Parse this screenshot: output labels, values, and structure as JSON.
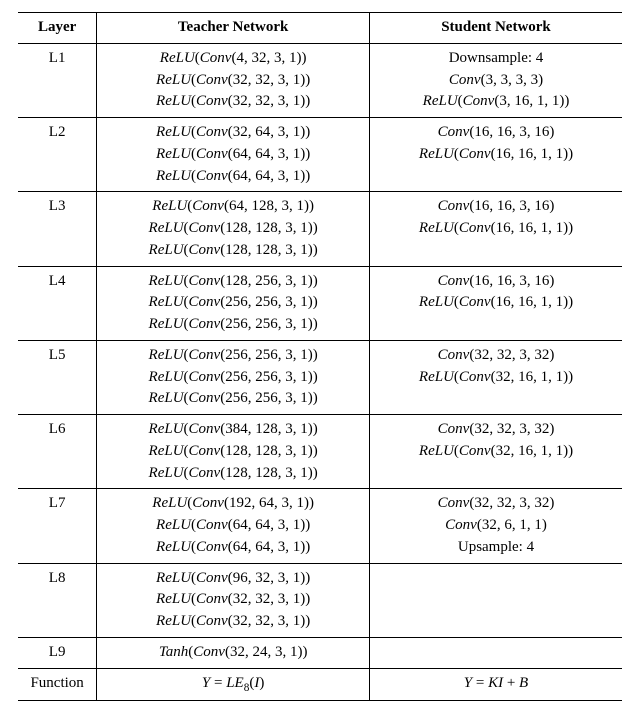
{
  "chart_data": {
    "type": "table",
    "columns": [
      "Layer",
      "Teacher Network",
      "Student Network"
    ],
    "rows": [
      {
        "layer": "L1",
        "teacher": [
          "ReLU(Conv(4, 32, 3, 1))",
          "ReLU(Conv(32, 32, 3, 1))",
          "ReLU(Conv(32, 32, 3, 1))"
        ],
        "student": [
          "Downsample: 4",
          "Conv(3, 3, 3, 3)",
          "ReLU(Conv(3, 16, 1, 1))"
        ]
      },
      {
        "layer": "L2",
        "teacher": [
          "ReLU(Conv(32, 64, 3, 1))",
          "ReLU(Conv(64, 64, 3, 1))",
          "ReLU(Conv(64, 64, 3, 1))"
        ],
        "student": [
          "Conv(16, 16, 3, 16)",
          "ReLU(Conv(16, 16, 1, 1))"
        ]
      },
      {
        "layer": "L3",
        "teacher": [
          "ReLU(Conv(64, 128, 3, 1))",
          "ReLU(Conv(128, 128, 3, 1))",
          "ReLU(Conv(128, 128, 3, 1))"
        ],
        "student": [
          "Conv(16, 16, 3, 16)",
          "ReLU(Conv(16, 16, 1, 1))"
        ]
      },
      {
        "layer": "L4",
        "teacher": [
          "ReLU(Conv(128, 256, 3, 1))",
          "ReLU(Conv(256, 256, 3, 1))",
          "ReLU(Conv(256, 256, 3, 1))"
        ],
        "student": [
          "Conv(16, 16, 3, 16)",
          "ReLU(Conv(16, 16, 1, 1))"
        ]
      },
      {
        "layer": "L5",
        "teacher": [
          "ReLU(Conv(256, 256, 3, 1))",
          "ReLU(Conv(256, 256, 3, 1))",
          "ReLU(Conv(256, 256, 3, 1))"
        ],
        "student": [
          "Conv(32, 32, 3, 32)",
          "ReLU(Conv(32, 16, 1, 1))"
        ]
      },
      {
        "layer": "L6",
        "teacher": [
          "ReLU(Conv(384, 128, 3, 1))",
          "ReLU(Conv(128, 128, 3, 1))",
          "ReLU(Conv(128, 128, 3, 1))"
        ],
        "student": [
          "Conv(32, 32, 3, 32)",
          "ReLU(Conv(32, 16, 1, 1))"
        ]
      },
      {
        "layer": "L7",
        "teacher": [
          "ReLU(Conv(192, 64, 3, 1))",
          "ReLU(Conv(64, 64, 3, 1))",
          "ReLU(Conv(64, 64, 3, 1))"
        ],
        "student": [
          "Conv(32, 32, 3, 32)",
          "Conv(32, 6, 1, 1)",
          "Upsample: 4"
        ]
      },
      {
        "layer": "L8",
        "teacher": [
          "ReLU(Conv(96, 32, 3, 1))",
          "ReLU(Conv(32, 32, 3, 1))",
          "ReLU(Conv(32, 32, 3, 1))"
        ],
        "student": []
      },
      {
        "layer": "L9",
        "teacher": [
          "Tanh(Conv(32, 24, 3, 1))"
        ],
        "student": []
      },
      {
        "layer": "Function",
        "teacher": {
          "formula": "Y = LE_8(I)"
        },
        "student": {
          "formula": "Y = K I + B"
        }
      }
    ]
  },
  "headers": {
    "c1": "Layer",
    "c2": "Teacher Network",
    "c3": "Student Network"
  },
  "rows": {
    "L1": {
      "layer": "L1",
      "t1": "(4, 32, 3, 1))",
      "t2": "(32, 32, 3, 1))",
      "t3": "(32, 32, 3, 1))",
      "s1": "Downsample: 4",
      "s2": "(3, 3, 3, 3)",
      "s3": "(3, 16, 1, 1))"
    },
    "L2": {
      "layer": "L2",
      "t1": "(32, 64, 3, 1))",
      "t2": "(64, 64, 3, 1))",
      "t3": "(64, 64, 3, 1))",
      "s1": "(16, 16, 3, 16)",
      "s2": "(16, 16, 1, 1))"
    },
    "L3": {
      "layer": "L3",
      "t1": "(64, 128, 3, 1))",
      "t2": "(128, 128, 3, 1))",
      "t3": "(128, 128, 3, 1))",
      "s1": "(16, 16, 3, 16)",
      "s2": "(16, 16, 1, 1))"
    },
    "L4": {
      "layer": "L4",
      "t1": "(128, 256, 3, 1))",
      "t2": "(256, 256, 3, 1))",
      "t3": "(256, 256, 3, 1))",
      "s1": "(16, 16, 3, 16)",
      "s2": "(16, 16, 1, 1))"
    },
    "L5": {
      "layer": "L5",
      "t1": "(256, 256, 3, 1))",
      "t2": "(256, 256, 3, 1))",
      "t3": "(256, 256, 3, 1))",
      "s1": "(32, 32, 3, 32)",
      "s2": "(32, 16, 1, 1))"
    },
    "L6": {
      "layer": "L6",
      "t1": "(384, 128, 3, 1))",
      "t2": "(128, 128, 3, 1))",
      "t3": "(128, 128, 3, 1))",
      "s1": "(32, 32, 3, 32)",
      "s2": "(32, 16, 1, 1))"
    },
    "L7": {
      "layer": "L7",
      "t1": "(192, 64, 3, 1))",
      "t2": "(64, 64, 3, 1))",
      "t3": "(64, 64, 3, 1))",
      "s1": "(32, 32, 3, 32)",
      "s2": "(32, 6, 1, 1)",
      "s3": "Upsample: 4"
    },
    "L8": {
      "layer": "L8",
      "t1": "(96, 32, 3, 1))",
      "t2": "(32, 32, 3, 1))",
      "t3": "(32, 32, 3, 1))"
    },
    "L9": {
      "layer": "L9",
      "t1": "(32, 24, 3, 1))"
    },
    "Fn": {
      "layer": "Function",
      "teacher_Y": "Y",
      "teacher_eq": " = ",
      "teacher_LE": "LE",
      "teacher_sub": "8",
      "teacher_I": "I",
      "student_Y": "Y",
      "student_eq": " = ",
      "student_K": "K",
      "student_I": "I",
      "student_plus": " + ",
      "student_B": "B"
    }
  },
  "tok": {
    "ReLU": "ReLU",
    "Tanh": "Tanh",
    "Conv": "Conv",
    "lp": "(",
    "rp": ")"
  }
}
